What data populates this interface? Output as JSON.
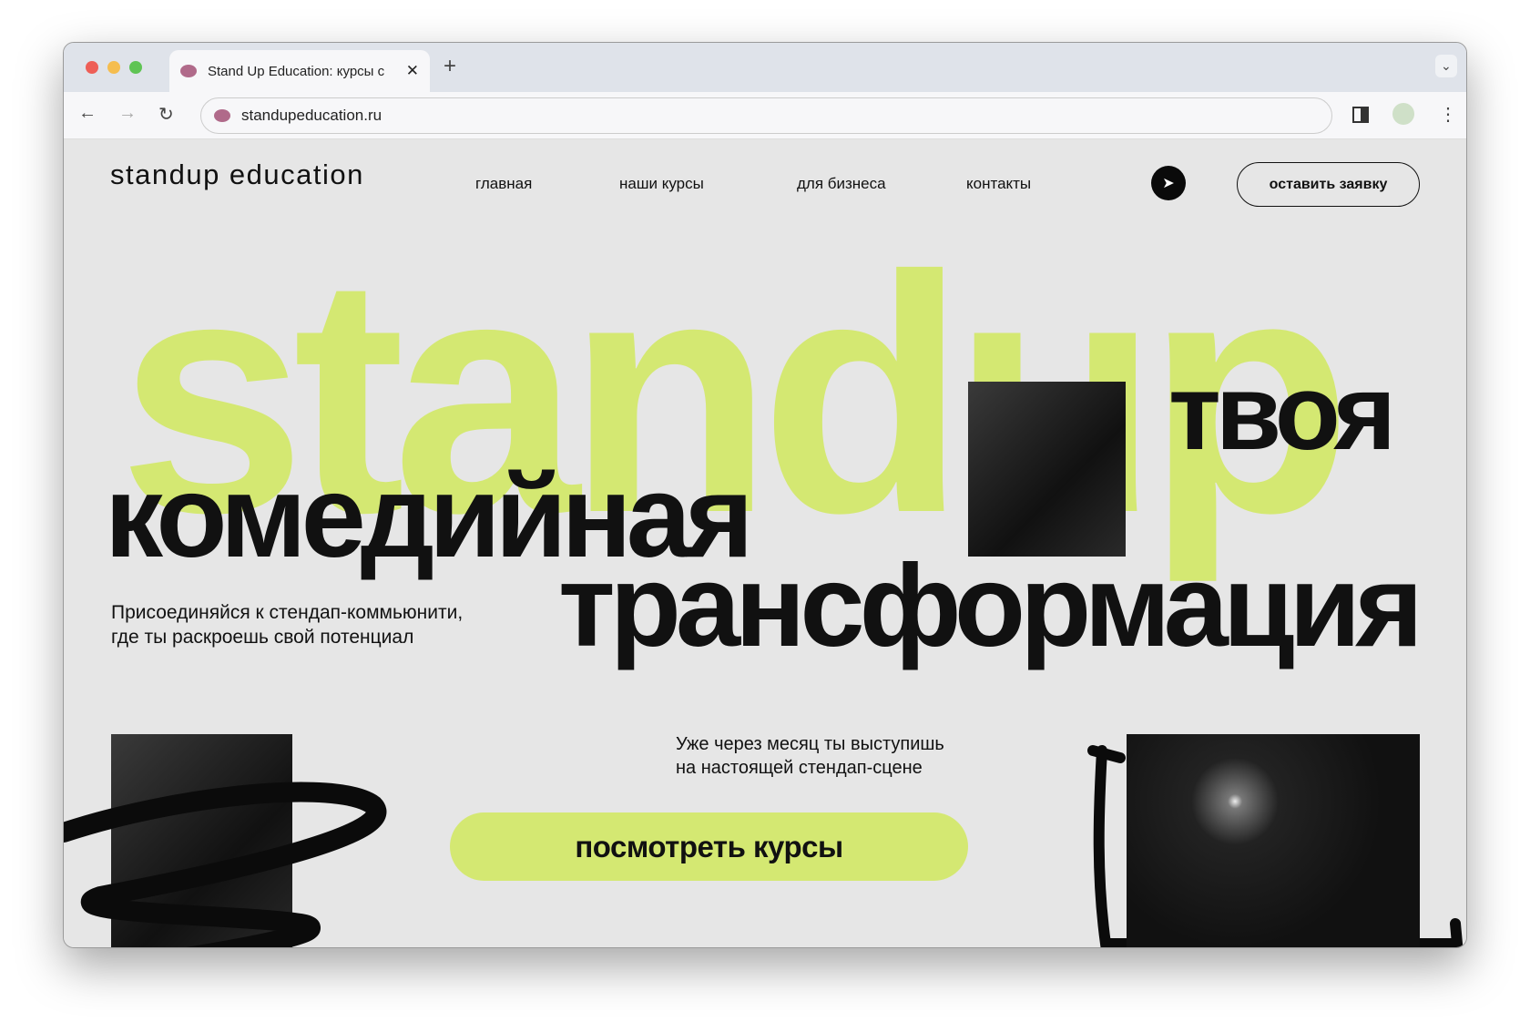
{
  "browser": {
    "tab_title": "Stand Up Education: курсы с",
    "url": "standupeducation.ru"
  },
  "header": {
    "logo": "standup education",
    "nav": [
      "главная",
      "наши курсы",
      "для бизнеса",
      "контакты"
    ],
    "cta": "оставить заявку"
  },
  "hero": {
    "background_word": "standup",
    "line1": "твоя",
    "line2": "комедийная",
    "line3": "трансформация",
    "subtitle_1": "Присоединяйся к стендап-коммьюнити,",
    "subtitle_2": "где ты раскроешь свой потенциал",
    "promo_1": "Уже через месяц ты выступишь",
    "promo_2": "на настоящей стендап-сцене",
    "button": "посмотреть курсы"
  },
  "colors": {
    "accent": "#d4e872",
    "background": "#e6e6e6",
    "text": "#111111"
  }
}
